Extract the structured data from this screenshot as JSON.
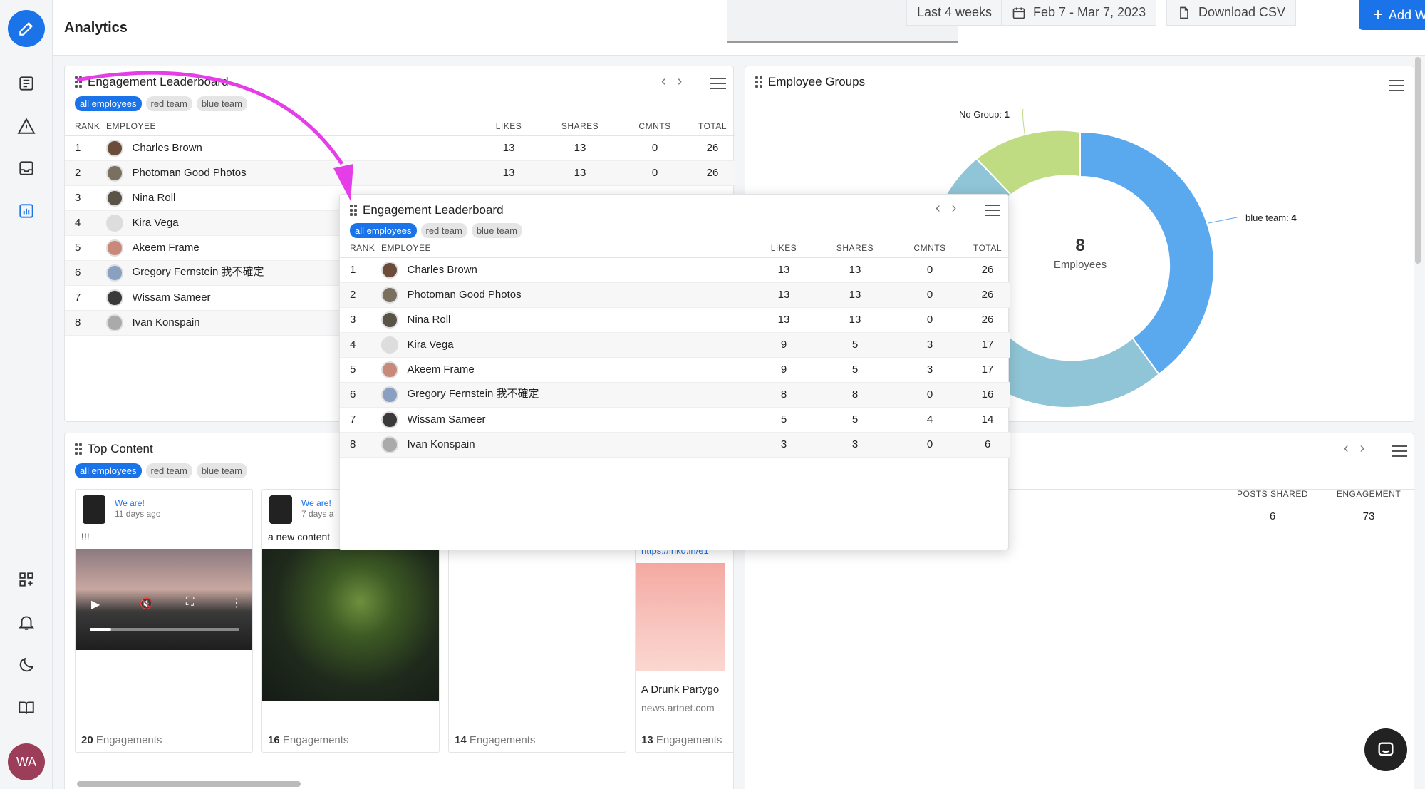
{
  "app": {
    "page_title": "Analytics",
    "user_initials": "WA"
  },
  "header": {
    "range_label": "Last 4 weeks",
    "date_range": "Feb 7 - Mar 7, 2023",
    "download_label": "Download CSV",
    "add_widget_label": "Add Widget"
  },
  "leaderboard": {
    "title": "Engagement Leaderboard",
    "tags": [
      "all employees",
      "red team",
      "blue team"
    ],
    "columns": [
      "RANK",
      "EMPLOYEE",
      "LIKES",
      "SHARES",
      "CMNTS",
      "TOTAL"
    ],
    "rows": [
      {
        "rank": "1",
        "name": "Charles Brown",
        "likes": "13",
        "shares": "13",
        "cmnts": "0",
        "total": "26"
      },
      {
        "rank": "2",
        "name": "Photoman Good Photos",
        "likes": "13",
        "shares": "13",
        "cmnts": "0",
        "total": "26"
      },
      {
        "rank": "3",
        "name": "Nina Roll",
        "likes": "13",
        "shares": "13",
        "cmnts": "0",
        "total": "26"
      },
      {
        "rank": "4",
        "name": "Kira Vega",
        "likes": "9",
        "shares": "5",
        "cmnts": "3",
        "total": "17"
      },
      {
        "rank": "5",
        "name": "Akeem Frame",
        "likes": "9",
        "shares": "5",
        "cmnts": "3",
        "total": "17"
      },
      {
        "rank": "6",
        "name": "Gregory Fernstein 我不確定",
        "likes": "8",
        "shares": "8",
        "cmnts": "0",
        "total": "16"
      },
      {
        "rank": "7",
        "name": "Wissam Sameer",
        "likes": "5",
        "shares": "5",
        "cmnts": "4",
        "total": "14"
      },
      {
        "rank": "8",
        "name": "Ivan Konspain",
        "likes": "3",
        "shares": "3",
        "cmnts": "0",
        "total": "6"
      }
    ]
  },
  "groups": {
    "title": "Employee Groups",
    "center_value": "8",
    "center_label": "Employees",
    "label_no_group": "No Group:",
    "label_no_group_value": "1",
    "label_blue": "blue team:",
    "label_blue_value": "4",
    "colors": [
      "#5aa9ee",
      "#8fc5d6",
      "#bfdc82"
    ]
  },
  "top_content": {
    "title": "Top Content",
    "tags": [
      "all employees",
      "red team",
      "blue team"
    ],
    "cards": [
      {
        "author": "We are!",
        "date": "11 days ago",
        "text": "!!!",
        "count": "20",
        "unit": "Engagements"
      },
      {
        "author": "We are!",
        "date": "7 days a",
        "text": "a new content",
        "count": "16",
        "unit": "Engagements"
      },
      {
        "author": "",
        "date": "",
        "text": "",
        "count": "14",
        "unit": "Engagements"
      },
      {
        "author": "",
        "date": "",
        "text": "https://lnkd.in/e1",
        "title": "A Drunk Partygo",
        "source": "news.artnet.com",
        "count": "13",
        "unit": "Engagements"
      }
    ]
  },
  "shares_widget": {
    "columns": [
      "POSTS SHARED",
      "ENGAGEMENT"
    ],
    "row": {
      "posts": "6",
      "engagement": "73"
    }
  }
}
